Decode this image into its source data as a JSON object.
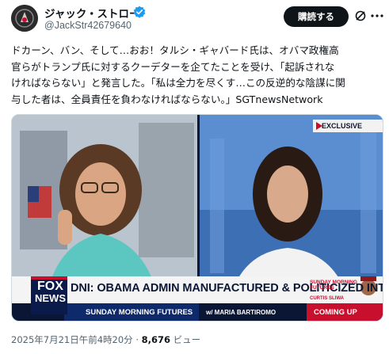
{
  "author": {
    "display_name": "ジャック・ストロー",
    "handle": "@JackStr42679640",
    "verified_icon": "verified-badge-icon"
  },
  "actions": {
    "subscribe_label": "購読する"
  },
  "tweet": {
    "lines": [
      "ドカーン、バン、そして…おお！タルシ・ギャバード氏は、オバマ政権高",
      "官らがトランプ氏に対するクーデターを企てたことを受け、「起訴されな",
      "ければならない」と発言した。「私は全力を尽くす…この反逆的な陰謀に関",
      "与した者は、全員責任を負わなければならない。」SGTnewsNetwork"
    ]
  },
  "media": {
    "exclusive_label": "EXCLUSIVE",
    "fox_line1": "FOX",
    "fox_line2": "NEWS",
    "headline": "DNI: OBAMA ADMIN MANUFACTURED & POLITICIZED INTEL",
    "show": "SUNDAY MORNING FUTURES",
    "host": "w/ MARIA BARTIROMO",
    "promo_show": "SUNDAY MORNING FUTURES",
    "promo_guest": "CURTIS SLIWA",
    "coming_up": "COMING UP"
  },
  "meta": {
    "timestamp": "2025年7月21日午前4時20分",
    "separator": " · ",
    "views_count": "8,676",
    "views_label": " ビュー"
  },
  "colors": {
    "accent": "#1d9bf0",
    "subscribe_bg": "#0f1419",
    "fox_red": "#c8102e",
    "chyron_navy": "#0a1633"
  }
}
